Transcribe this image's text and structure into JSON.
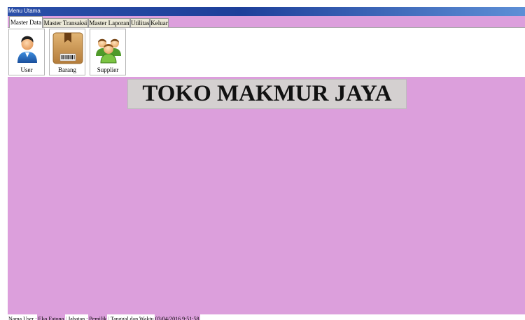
{
  "window": {
    "title": "Menu Utama"
  },
  "tabs": [
    {
      "label": "Master Data",
      "active": true
    },
    {
      "label": "Master Transaksi",
      "active": false
    },
    {
      "label": "Master Laporan",
      "active": false
    },
    {
      "label": "Utilitas",
      "active": false
    },
    {
      "label": "Keluar",
      "active": false
    }
  ],
  "ribbon": {
    "buttons": [
      {
        "label": "User",
        "icon": "user-icon"
      },
      {
        "label": "Barang",
        "icon": "box-icon"
      },
      {
        "label": "Supplier",
        "icon": "group-icon"
      }
    ]
  },
  "main": {
    "banner": "TOKO MAKMUR JAYA",
    "background": "#dc9fdc"
  },
  "statusbar": {
    "user_label": "Nama User :",
    "user_value": "Eko Fatono",
    "role_label": "Jabatan :",
    "role_value": "Pemilik",
    "datetime_label": "Tanggal dan Waktu",
    "datetime_value": "03/04/2016 9:51:58"
  }
}
